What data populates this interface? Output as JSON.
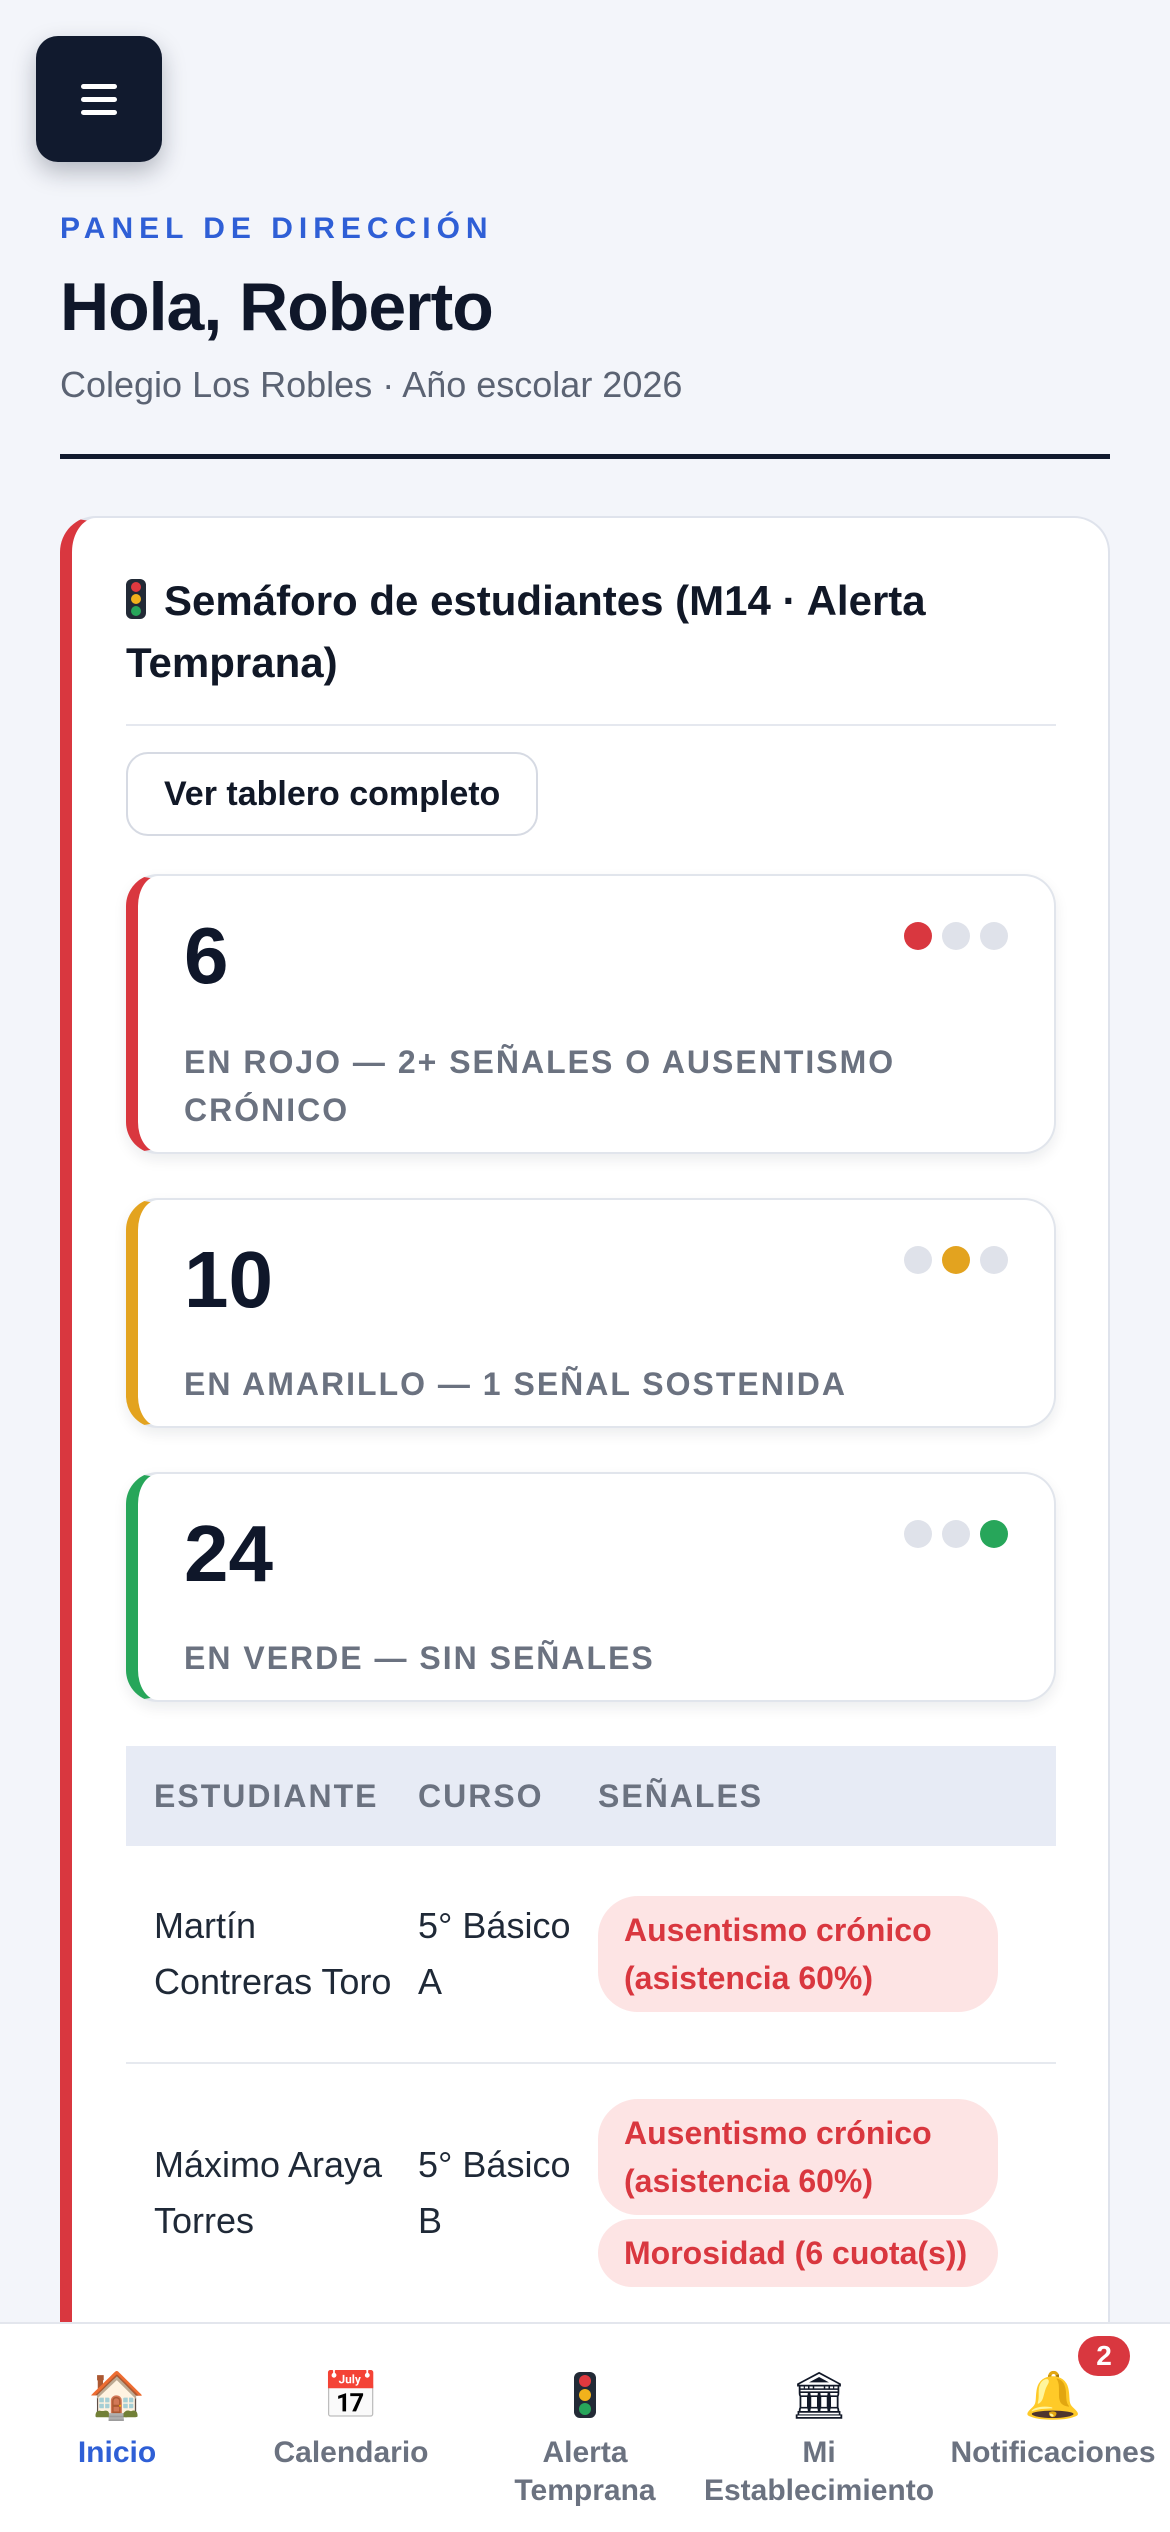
{
  "header": {
    "eyebrow": "PANEL DE DIRECCIÓN",
    "title": "Hola, Roberto",
    "subtitle": "Colegio Los Robles · Año escolar 2026"
  },
  "semaforo": {
    "title": "Semáforo de estudiantes (M14 · Alerta Temprana)",
    "view_all_label": "Ver tablero completo",
    "stats": [
      {
        "count": "6",
        "label": "EN ROJO — 2+ SEÑALES O AUSENTISMO CRÓNICO",
        "status": "red"
      },
      {
        "count": "10",
        "label": "EN AMARILLO — 1 SEÑAL SOSTENIDA",
        "status": "yellow"
      },
      {
        "count": "24",
        "label": "EN VERDE — SIN SEÑALES",
        "status": "green"
      }
    ],
    "table": {
      "headers": [
        "ESTUDIANTE",
        "CURSO",
        "SEÑALES"
      ],
      "rows": [
        {
          "student": "Martín Contreras Toro",
          "course": "5° Básico A",
          "signals": [
            "Ausentismo crónico (asistencia 60%)"
          ]
        },
        {
          "student": "Máximo Araya Torres",
          "course": "5° Básico B",
          "signals": [
            "Ausentismo crónico (asistencia 60%)",
            "Morosidad (6 cuota(s))"
          ]
        }
      ]
    }
  },
  "colors": {
    "accent": "#2f5fd6",
    "dark": "#111a2e",
    "red": "#d9373f",
    "yellow": "#e3a31f",
    "green": "#27a65a"
  },
  "bottom_nav": {
    "items": [
      {
        "label": "Inicio",
        "icon": "house-icon",
        "active": true
      },
      {
        "label": "Calendario",
        "icon": "calendar-icon"
      },
      {
        "label": "Alerta Temprana",
        "icon": "traffic-light-icon"
      },
      {
        "label": "Mi Establecimiento",
        "icon": "institution-icon"
      },
      {
        "label": "Notificaciones",
        "icon": "bell-icon",
        "badge": "2"
      }
    ]
  }
}
